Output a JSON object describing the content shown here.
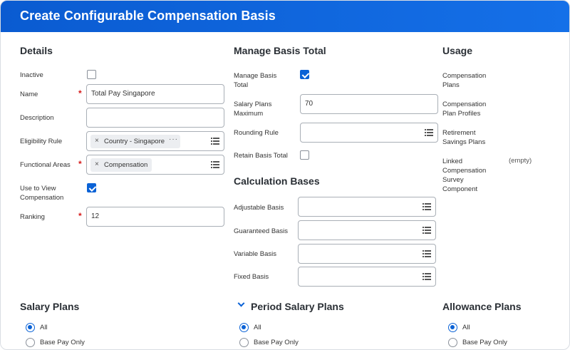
{
  "header": {
    "title": "Create Configurable Compensation Basis"
  },
  "details": {
    "title": "Details",
    "inactive_label": "Inactive",
    "name_label": "Name",
    "name_value": "Total Pay Singapore",
    "description_label": "Description",
    "description_value": "",
    "eligibility_label": "Eligibility Rule",
    "eligibility_chip": "Country - Singapore",
    "eligibility_more": "···",
    "functional_label": "Functional Areas",
    "functional_chip": "Compensation",
    "use_to_view_label_1": "Use to View",
    "use_to_view_label_2": "Compensation",
    "ranking_label": "Ranking",
    "ranking_value": "12"
  },
  "manage": {
    "title": "Manage Basis Total",
    "manage_label_1": "Manage Basis",
    "manage_label_2": "Total",
    "salary_max_label_1": "Salary Plans",
    "salary_max_label_2": "Maximum",
    "salary_max_value": "70",
    "rounding_label": "Rounding Rule",
    "retain_label": "Retain Basis Total"
  },
  "calc": {
    "title": "Calculation Bases",
    "adjustable_label": "Adjustable Basis",
    "guaranteed_label": "Guaranteed Basis",
    "variable_label": "Variable Basis",
    "fixed_label": "Fixed Basis"
  },
  "usage": {
    "title": "Usage",
    "comp_plans_1": "Compensation",
    "comp_plans_2": "Plans",
    "comp_profiles_1": "Compensation",
    "comp_profiles_2": "Plan Profiles",
    "retirement_1": "Retirement",
    "retirement_2": "Savings Plans",
    "linked_1": "Linked",
    "linked_2": "Compensation",
    "linked_3": "Survey",
    "linked_4": "Component",
    "linked_value": "(empty)"
  },
  "salary_plans": {
    "title": "Salary Plans",
    "opt_all": "All",
    "opt_base": "Base Pay Only"
  },
  "period_plans": {
    "title": "Period Salary Plans",
    "opt_all": "All",
    "opt_base": "Base Pay Only"
  },
  "allowance_plans": {
    "title": "Allowance Plans",
    "opt_all": "All",
    "opt_base": "Base Pay Only"
  },
  "colors": {
    "header": "#0a5bd1",
    "accent": "#0a62d6",
    "required": "#d61a1a"
  },
  "icons": {
    "list": "list-icon",
    "remove": "remove-x-icon",
    "collapse": "chevron-down-icon"
  }
}
